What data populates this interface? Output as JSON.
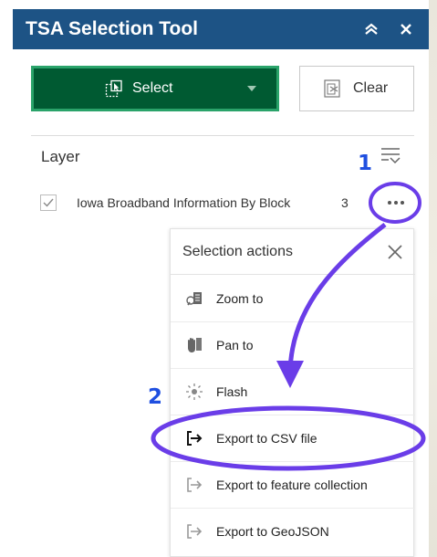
{
  "panel": {
    "title": "TSA Selection Tool",
    "header_icons": [
      "collapse-icon",
      "close-icon"
    ],
    "header_color": "#1d5385"
  },
  "toolbar": {
    "select_label": "Select",
    "clear_label": "Clear",
    "select_color": "#005a32"
  },
  "layers": {
    "heading": "Layer",
    "items": [
      {
        "name": "Iowa Broadband Information By Block",
        "count": "3",
        "checked": true
      }
    ]
  },
  "selection_actions": {
    "title": "Selection actions",
    "items": [
      {
        "label": "Zoom to",
        "icon": "zoom-to-icon"
      },
      {
        "label": "Pan to",
        "icon": "pan-to-icon"
      },
      {
        "label": "Flash",
        "icon": "flash-icon"
      },
      {
        "label": "Export to CSV file",
        "icon": "export-icon"
      },
      {
        "label": "Export to feature collection",
        "icon": "export-icon"
      },
      {
        "label": "Export to GeoJSON",
        "icon": "export-icon"
      }
    ]
  },
  "annotations": {
    "step1": "1",
    "step2": "2",
    "color": "#6a3de8"
  }
}
